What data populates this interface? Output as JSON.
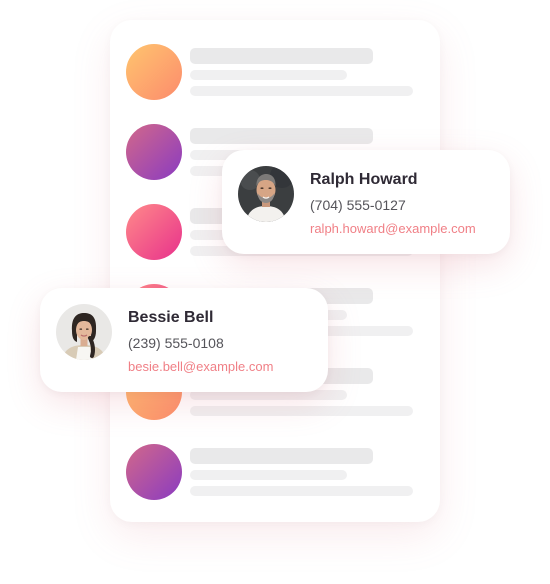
{
  "colors": {
    "accent_email": "#f07f86",
    "gradient_orange": [
      "#ffc56f",
      "#fc8b6c"
    ],
    "gradient_purple": [
      "#d2688a",
      "#8a3bc1"
    ],
    "gradient_pink": [
      "#ff8a8a",
      "#e8318b"
    ]
  },
  "list": {
    "rows": [
      {
        "avatar": "orange-gradient-placeholder"
      },
      {
        "avatar": "purple-gradient-placeholder"
      },
      {
        "avatar": "pink-gradient-placeholder"
      },
      {
        "avatar": "pink-gradient-placeholder"
      },
      {
        "avatar": "orange-gradient-placeholder"
      },
      {
        "avatar": "purple-gradient-placeholder"
      }
    ]
  },
  "contacts": [
    {
      "name": "Ralph Howard",
      "phone": "(704) 555-0127",
      "email": "ralph.howard@example.com",
      "avatar": "man-with-beard-photo"
    },
    {
      "name": "Bessie Bell",
      "phone": "(239) 555-0108",
      "email": "besie.bell@example.com",
      "avatar": "woman-with-braid-photo"
    }
  ]
}
